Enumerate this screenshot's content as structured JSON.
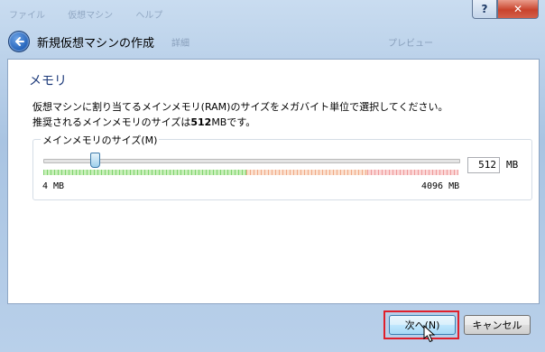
{
  "window": {
    "ghost_menu": [
      "ファイル",
      "仮想マシン",
      "ヘルプ"
    ],
    "help_label": "?",
    "close_label": "✕"
  },
  "header": {
    "title": "新規仮想マシンの作成",
    "ghost_tab_details": "詳細",
    "ghost_tab_preview": "プレビュー"
  },
  "page": {
    "section_title": "メモリ",
    "desc_line1": "仮想マシンに割り当てるメインメモリ(RAM)のサイズをメガバイト単位で選択してください。",
    "desc_line2_pre": "推奨されるメインメモリのサイズは",
    "desc_line2_bold": "512",
    "desc_line2_post": "MBです。"
  },
  "memory": {
    "legend": "メインメモリのサイズ(M)",
    "value": "512",
    "unit": "MB",
    "min_label": "4 MB",
    "max_label": "4096 MB",
    "slider_fraction": 0.125
  },
  "footer": {
    "next_label": "次へ(N)",
    "cancel_label": "キャンセル"
  },
  "colors": {
    "accent": "#1d3a7a",
    "highlight": "#e0202c"
  },
  "icons": [
    "back-arrow-icon",
    "mouse-cursor-icon"
  ]
}
